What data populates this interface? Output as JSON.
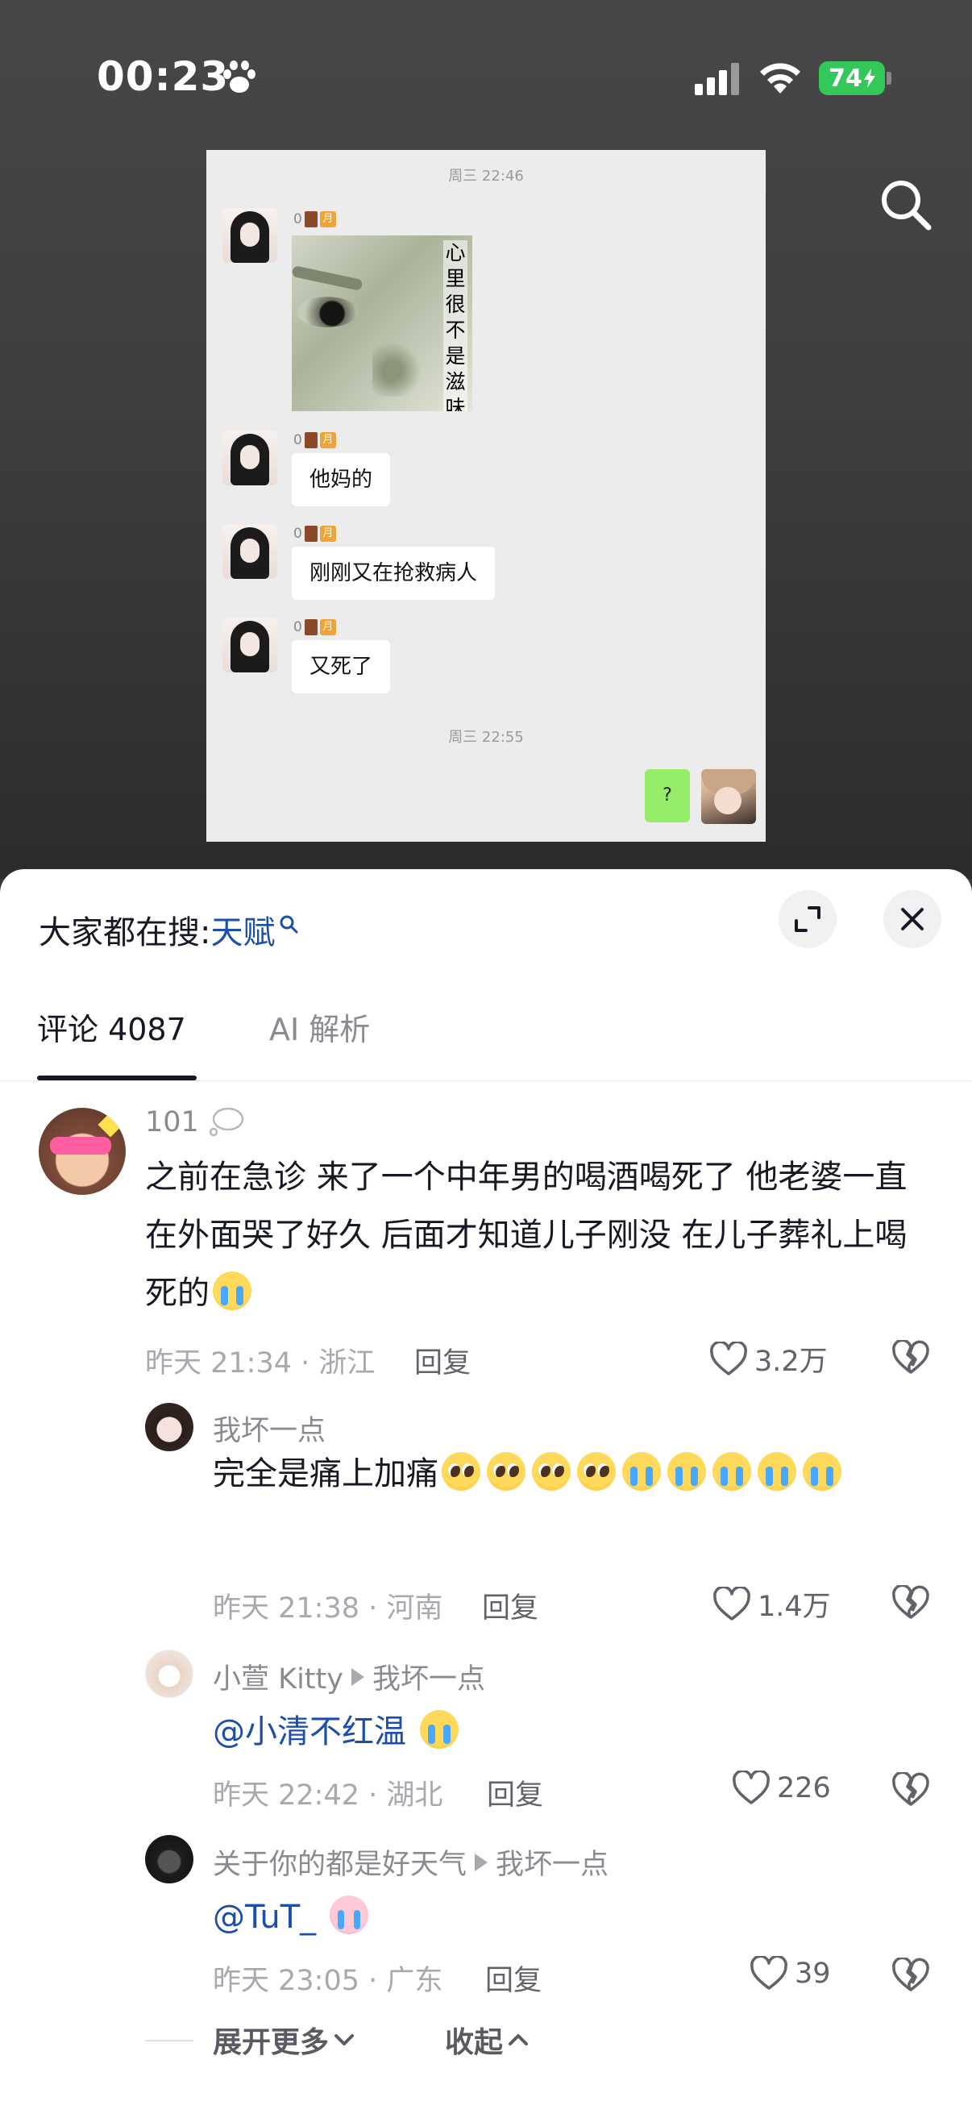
{
  "status_bar": {
    "time": "00:23",
    "battery": "74",
    "icons": [
      "paw-icon",
      "cellular-signal-icon",
      "wifi-icon",
      "charging-bolt-icon"
    ]
  },
  "video": {
    "chat_screenshot": {
      "time1": "周三 22:46",
      "time2": "周三 22:55",
      "sender_name": "0",
      "level_badge": "月",
      "meme_caption": "心里很不是滋味",
      "messages": [
        "他妈的",
        "刚刚又在抢救病人",
        "又死了"
      ],
      "my_message": "?"
    }
  },
  "sheet": {
    "hot_search_label": "大家都在搜:",
    "hot_search_keyword": "天赋",
    "tabs": {
      "comments": "评论 4087",
      "ai": "AI 解析"
    },
    "comments": [
      {
        "username": "101",
        "text": "之前在急诊 来了一个中年男的喝酒喝死了 他老婆一直在外面哭了好久 后面才知道儿子刚没 在儿子葬礼上喝死的",
        "meta": "昨天 21:34 · 浙江",
        "reply": "回复",
        "likes": "3.2万"
      },
      {
        "username": "我坏一点",
        "text": "完全是痛上加痛",
        "meta": "昨天 21:38 · 河南",
        "reply": "回复",
        "likes": "1.4万"
      },
      {
        "username": "小萱 Kitty",
        "reply_to": "我坏一点",
        "text": "@小清不红温",
        "meta": "昨天 22:42 · 湖北",
        "reply": "回复",
        "likes": "226"
      },
      {
        "username": "关于你的都是好天气",
        "reply_to": "我坏一点",
        "text": "@TuT_",
        "meta": "昨天 23:05 · 广东",
        "reply": "回复",
        "likes": "39"
      }
    ],
    "expand_more": "展开更多",
    "collapse": "收起"
  },
  "colors": {
    "accent_blue": "#1e4fa8",
    "battery_green": "#34c759",
    "wechat_green": "#95ec69"
  }
}
